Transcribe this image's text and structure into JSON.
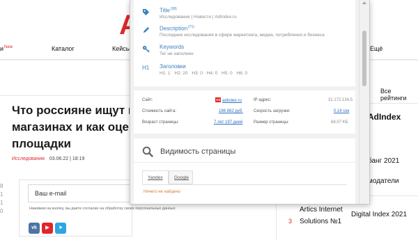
{
  "site": {
    "logo_partial": "A",
    "nav": {
      "item1": "и",
      "item1_new": "New",
      "catalog": "Каталог",
      "cases": "Кейсы",
      "more": "Ещё"
    },
    "all_ratings": "Все рейтинги",
    "headline": [
      "Что россияне ищут в",
      "магазинах и как оце",
      "площадки"
    ],
    "meta_tag": "Исследования",
    "meta_date": "03.06.22 | 18:19",
    "side_numbers": [
      "8",
      "1",
      "1",
      "0"
    ],
    "subscribe": {
      "email_placeholder": "Ваш e-mail",
      "consent": "Нажимая на кнопку, вы даете согласие на обработку своих персональных данных"
    },
    "socials": [
      "vk",
      "youtube",
      "telegram"
    ],
    "rating": {
      "title": "AdIndex",
      "line1": "банг 2021",
      "line2": "модатели",
      "line3": "Digital Index 2021",
      "rank": "3",
      "company_line1": "Artics Internet",
      "company_line2": "Solutions №1"
    }
  },
  "popup": {
    "seo": {
      "title": {
        "label": "Title",
        "count": "(38)",
        "value": "Исследования | Новости | AdIndex.ru"
      },
      "description": {
        "label": "Description",
        "count": "(71)",
        "value": "Последние исследования в сфере маркетинга, медиа, потребления и бизнеса"
      },
      "keywords": {
        "label": "Keywords",
        "value": "Тег не заполнен"
      },
      "headings": {
        "label": "Заголовки",
        "icon_text": "H1",
        "items": [
          "H1: 1",
          "H2: 20",
          "H3: 0",
          "H4: 0",
          "H5: 0",
          "H6: 0"
        ]
      }
    },
    "stats": {
      "site_label": "Сайт:",
      "site_badge": "Ad",
      "site_value": "adindex.ru",
      "ip_label": "IP адрес:",
      "ip_value": "31.172.134.5",
      "cost_label": "Стоимость сайта:",
      "cost_value": "186 882 руб.",
      "speed_label": "Скорость загрузки:",
      "speed_value": "0.14 сек",
      "age_label": "Возраст страницы:",
      "age_value": "7 лет 197 дней",
      "size_label": "Размер страницы:",
      "size_value": "68.07 KБ"
    },
    "visibility": {
      "title": "Видимость страницы",
      "tab_yandex": "Yandex",
      "tab_google": "Google",
      "not_found": "Ничего не найдено"
    }
  },
  "colors": {
    "brand_red": "#e0262a",
    "link_blue": "#2a6fc2",
    "icon_blue": "#3e80c0",
    "warning_orange": "#e07a3a"
  }
}
